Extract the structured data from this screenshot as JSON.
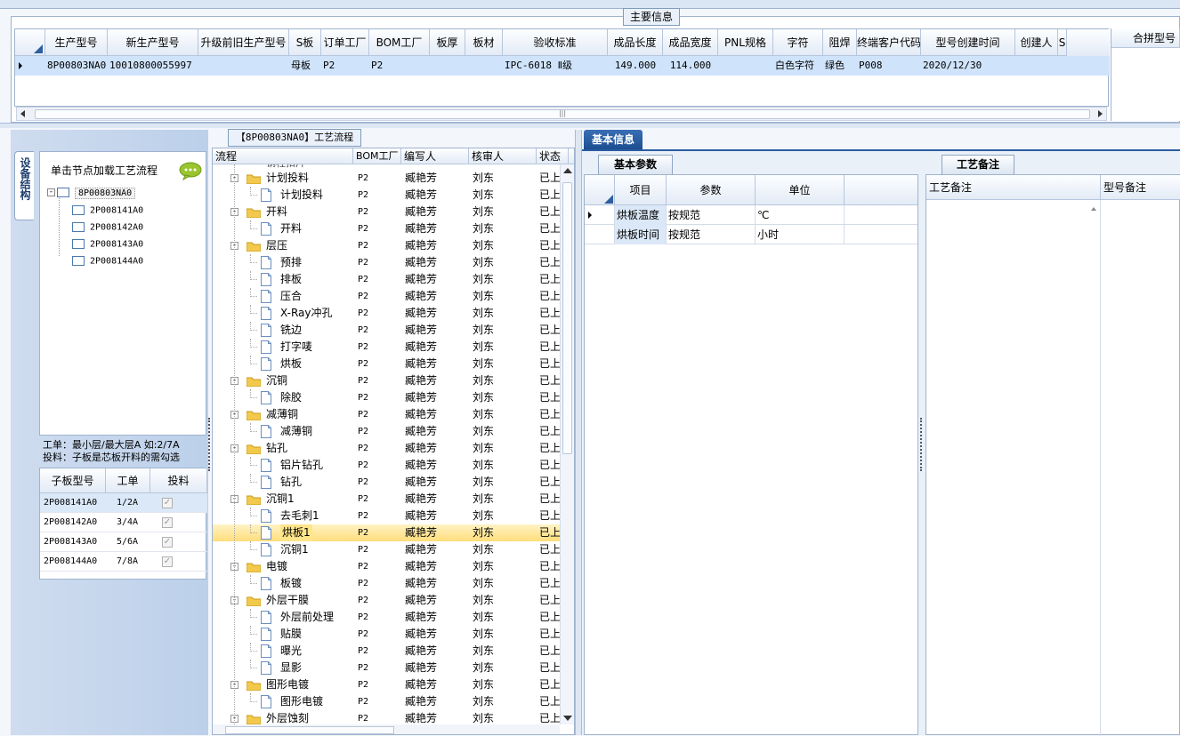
{
  "main_info": {
    "caption": "主要信息",
    "columns": [
      "生产型号",
      "新生产型号",
      "升级前旧生产型号",
      "S板",
      "订单工厂",
      "BOM工厂",
      "板厚",
      "板材",
      "验收标准",
      "成品长度",
      "成品宽度",
      "PNL规格",
      "字符",
      "阻焊",
      "终端客户代码",
      "型号创建时间",
      "创建人",
      "S"
    ],
    "row": [
      "8P00803NA0",
      "10010800055997",
      "",
      "母板",
      "P2",
      "P2",
      "",
      "",
      "IPC-6018 Ⅱ级",
      "149.000",
      "114.000",
      "",
      "白色字符",
      "绿色",
      "P008",
      "2020/12/30",
      "",
      ""
    ],
    "merge_caption": "合拼型号"
  },
  "left_panel": {
    "vertical_tab": "设备结构",
    "hint": "单击节点加载工艺流程",
    "tree_root": "8P00803NA0",
    "tree_children": [
      "2P008141A0",
      "2P008142A0",
      "2P008143A0",
      "2P008144A0"
    ],
    "note_line1": "工单：最小层/最大层A 如:2/7A",
    "note_line2": "投料：子板是芯板开料的需勾选",
    "sub_headers": [
      "子板型号",
      "工单",
      "投料"
    ],
    "sub_rows": [
      {
        "model": "2P008141A0",
        "order": "1/2A",
        "checked": true
      },
      {
        "model": "2P008142A0",
        "order": "3/4A",
        "checked": true
      },
      {
        "model": "2P008143A0",
        "order": "5/6A",
        "checked": true
      },
      {
        "model": "2P008144A0",
        "order": "7/8A",
        "checked": true
      }
    ]
  },
  "process": {
    "caption": "【8P00803NA0】工艺流程",
    "headers": [
      "流程",
      "BOM工厂",
      "编写人",
      "核审人",
      "状态"
    ],
    "partial_top": "钢柱扣片",
    "rows": [
      {
        "name": "计划投料",
        "level": 0,
        "bom": "P2",
        "writer": "臧艳芳",
        "reviewer": "刘东",
        "status": "已上"
      },
      {
        "name": "计划投料",
        "level": 1,
        "bom": "P2",
        "writer": "臧艳芳",
        "reviewer": "刘东",
        "status": "已上"
      },
      {
        "name": "开料",
        "level": 0,
        "bom": "P2",
        "writer": "臧艳芳",
        "reviewer": "刘东",
        "status": "已上"
      },
      {
        "name": "开料",
        "level": 1,
        "bom": "P2",
        "writer": "臧艳芳",
        "reviewer": "刘东",
        "status": "已上"
      },
      {
        "name": "层压",
        "level": 0,
        "bom": "P2",
        "writer": "臧艳芳",
        "reviewer": "刘东",
        "status": "已上"
      },
      {
        "name": "预排",
        "level": 1,
        "bom": "P2",
        "writer": "臧艳芳",
        "reviewer": "刘东",
        "status": "已上"
      },
      {
        "name": "排板",
        "level": 1,
        "bom": "P2",
        "writer": "臧艳芳",
        "reviewer": "刘东",
        "status": "已上"
      },
      {
        "name": "压合",
        "level": 1,
        "bom": "P2",
        "writer": "臧艳芳",
        "reviewer": "刘东",
        "status": "已上"
      },
      {
        "name": "X-Ray冲孔",
        "level": 1,
        "bom": "P2",
        "writer": "臧艳芳",
        "reviewer": "刘东",
        "status": "已上"
      },
      {
        "name": "铣边",
        "level": 1,
        "bom": "P2",
        "writer": "臧艳芳",
        "reviewer": "刘东",
        "status": "已上"
      },
      {
        "name": "打字唛",
        "level": 1,
        "bom": "P2",
        "writer": "臧艳芳",
        "reviewer": "刘东",
        "status": "已上"
      },
      {
        "name": "烘板",
        "level": 1,
        "bom": "P2",
        "writer": "臧艳芳",
        "reviewer": "刘东",
        "status": "已上"
      },
      {
        "name": "沉铜",
        "level": 0,
        "bom": "P2",
        "writer": "臧艳芳",
        "reviewer": "刘东",
        "status": "已上"
      },
      {
        "name": "除胶",
        "level": 1,
        "bom": "P2",
        "writer": "臧艳芳",
        "reviewer": "刘东",
        "status": "已上"
      },
      {
        "name": "减薄铜",
        "level": 0,
        "bom": "P2",
        "writer": "臧艳芳",
        "reviewer": "刘东",
        "status": "已上"
      },
      {
        "name": "减薄铜",
        "level": 1,
        "bom": "P2",
        "writer": "臧艳芳",
        "reviewer": "刘东",
        "status": "已上"
      },
      {
        "name": "钻孔",
        "level": 0,
        "bom": "P2",
        "writer": "臧艳芳",
        "reviewer": "刘东",
        "status": "已上"
      },
      {
        "name": "铝片钻孔",
        "level": 1,
        "bom": "P2",
        "writer": "臧艳芳",
        "reviewer": "刘东",
        "status": "已上"
      },
      {
        "name": "钻孔",
        "level": 1,
        "bom": "P2",
        "writer": "臧艳芳",
        "reviewer": "刘东",
        "status": "已上"
      },
      {
        "name": "沉铜1",
        "level": 0,
        "bom": "P2",
        "writer": "臧艳芳",
        "reviewer": "刘东",
        "status": "已上"
      },
      {
        "name": "去毛刺1",
        "level": 1,
        "bom": "P2",
        "writer": "臧艳芳",
        "reviewer": "刘东",
        "status": "已上"
      },
      {
        "name": "烘板1",
        "level": 1,
        "bom": "P2",
        "writer": "臧艳芳",
        "reviewer": "刘东",
        "status": "已上",
        "selected": true
      },
      {
        "name": "沉铜1",
        "level": 1,
        "bom": "P2",
        "writer": "臧艳芳",
        "reviewer": "刘东",
        "status": "已上"
      },
      {
        "name": "电镀",
        "level": 0,
        "bom": "P2",
        "writer": "臧艳芳",
        "reviewer": "刘东",
        "status": "已上"
      },
      {
        "name": "板镀",
        "level": 1,
        "bom": "P2",
        "writer": "臧艳芳",
        "reviewer": "刘东",
        "status": "已上"
      },
      {
        "name": "外层干膜",
        "level": 0,
        "bom": "P2",
        "writer": "臧艳芳",
        "reviewer": "刘东",
        "status": "已上"
      },
      {
        "name": "外层前处理",
        "level": 1,
        "bom": "P2",
        "writer": "臧艳芳",
        "reviewer": "刘东",
        "status": "已上"
      },
      {
        "name": "贴膜",
        "level": 1,
        "bom": "P2",
        "writer": "臧艳芳",
        "reviewer": "刘东",
        "status": "已上"
      },
      {
        "name": "曝光",
        "level": 1,
        "bom": "P2",
        "writer": "臧艳芳",
        "reviewer": "刘东",
        "status": "已上"
      },
      {
        "name": "显影",
        "level": 1,
        "bom": "P2",
        "writer": "臧艳芳",
        "reviewer": "刘东",
        "status": "已上"
      },
      {
        "name": "图形电镀",
        "level": 0,
        "bom": "P2",
        "writer": "臧艳芳",
        "reviewer": "刘东",
        "status": "已上"
      },
      {
        "name": "图形电镀",
        "level": 1,
        "bom": "P2",
        "writer": "臧艳芳",
        "reviewer": "刘东",
        "status": "已上"
      },
      {
        "name": "外层蚀刻",
        "level": 0,
        "bom": "P2",
        "writer": "臧艳芳",
        "reviewer": "刘东",
        "status": "已上"
      }
    ]
  },
  "basic_info": {
    "tab": "基本信息",
    "params_tab": "基本参数",
    "headers": [
      "项目",
      "参数",
      "单位"
    ],
    "rows": [
      {
        "item": "烘板温度",
        "param": "按规范",
        "unit": "℃"
      },
      {
        "item": "烘板时间",
        "param": "按规范",
        "unit": "小时"
      }
    ]
  },
  "notes": {
    "tab": "工艺备注",
    "col1": "工艺备注",
    "col2": "型号备注"
  }
}
